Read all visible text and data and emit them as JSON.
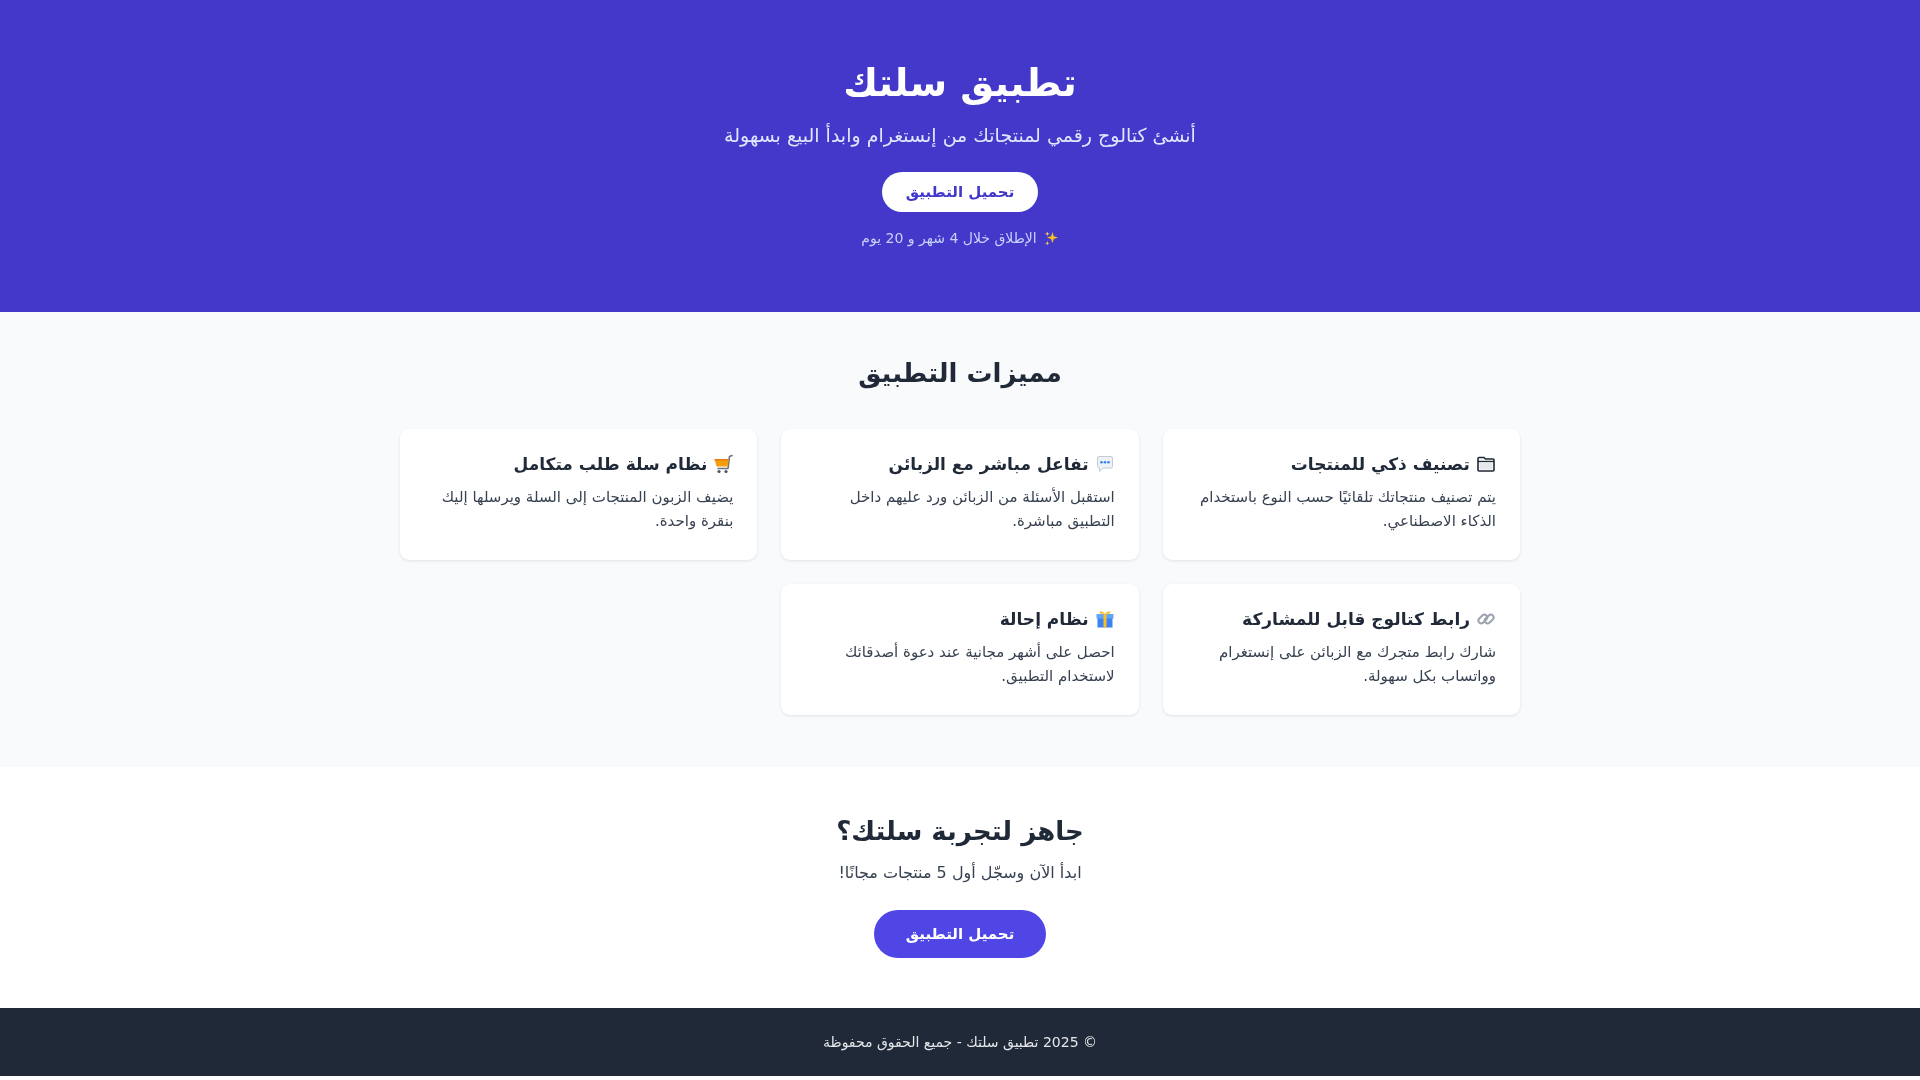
{
  "hero": {
    "title": "تطبيق سلتك",
    "subtitle": "أنشئ كتالوج رقمي لمنتجاتك من إنستغرام وابدأ البيع بسهولة",
    "button": "تحميل التطبيق",
    "launch_note": "الإطلاق خلال 4 شهر و 20 يوم"
  },
  "features": {
    "heading": "مميزات التطبيق",
    "items": [
      {
        "kind": "folder",
        "title": "تصنيف ذكي للمنتجات",
        "description": "يتم تصنيف منتجاتك تلقائيًا حسب النوع باستخدام الذكاء الاصطناعي."
      },
      {
        "kind": "chat",
        "title": "تفاعل مباشر مع الزبائن",
        "description": "استقبل الأسئلة من الزبائن ورد عليهم داخل التطبيق مباشرة."
      },
      {
        "kind": "cart",
        "title": "نظام سلة طلب متكامل",
        "description": "يضيف الزبون المنتجات إلى السلة ويرسلها إليك بنقرة واحدة."
      },
      {
        "kind": "link",
        "title": "رابط كتالوج قابل للمشاركة",
        "description": "شارك رابط متجرك مع الزبائن على إنستغرام وواتساب بكل سهولة."
      },
      {
        "kind": "gift",
        "title": "نظام إحالة",
        "description": "احصل على أشهر مجانية عند دعوة أصدقائك لاستخدام التطبيق."
      }
    ]
  },
  "cta": {
    "heading": "جاهز لتجربة سلتك؟",
    "text": "ابدأ الآن وسجّل أول 5 منتجات مجانًا!",
    "button": "تحميل التطبيق"
  },
  "footer": {
    "text": "© 2025 تطبيق سلتك - جميع الحقوق محفوظة"
  }
}
